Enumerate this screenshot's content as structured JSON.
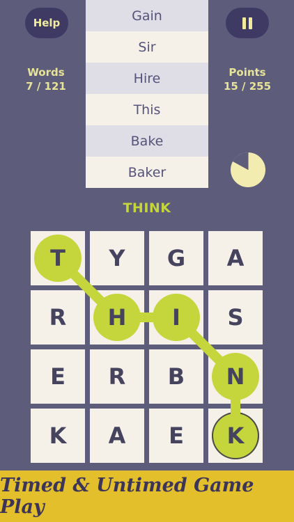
{
  "header": {
    "help_label": "Help",
    "words_label": "Words",
    "words_value": "7 / 121",
    "points_label": "Points",
    "points_value": "15 / 255"
  },
  "word_list": [
    "Gain",
    "Sir",
    "Hire",
    "This",
    "Bake",
    "Baker"
  ],
  "timer": {
    "icon": "timer-icon",
    "elapsed_fraction": 0.83
  },
  "current_word": "THINK",
  "grid": {
    "rows": [
      [
        "T",
        "Y",
        "G",
        "A"
      ],
      [
        "R",
        "H",
        "I",
        "S"
      ],
      [
        "E",
        "R",
        "B",
        "N"
      ],
      [
        "K",
        "A",
        "E",
        "K"
      ]
    ],
    "selected_path": [
      [
        0,
        0
      ],
      [
        1,
        1
      ],
      [
        1,
        2
      ],
      [
        2,
        3
      ],
      [
        3,
        3
      ]
    ]
  },
  "banner": "Timed & Untimed Game Play",
  "colors": {
    "background": "#5d5c7a",
    "button": "#3e3a63",
    "accent": "#c4d63c",
    "text_yellow": "#e8e39a",
    "tile": "#f6f1e8",
    "banner": "#e3bf2c"
  }
}
